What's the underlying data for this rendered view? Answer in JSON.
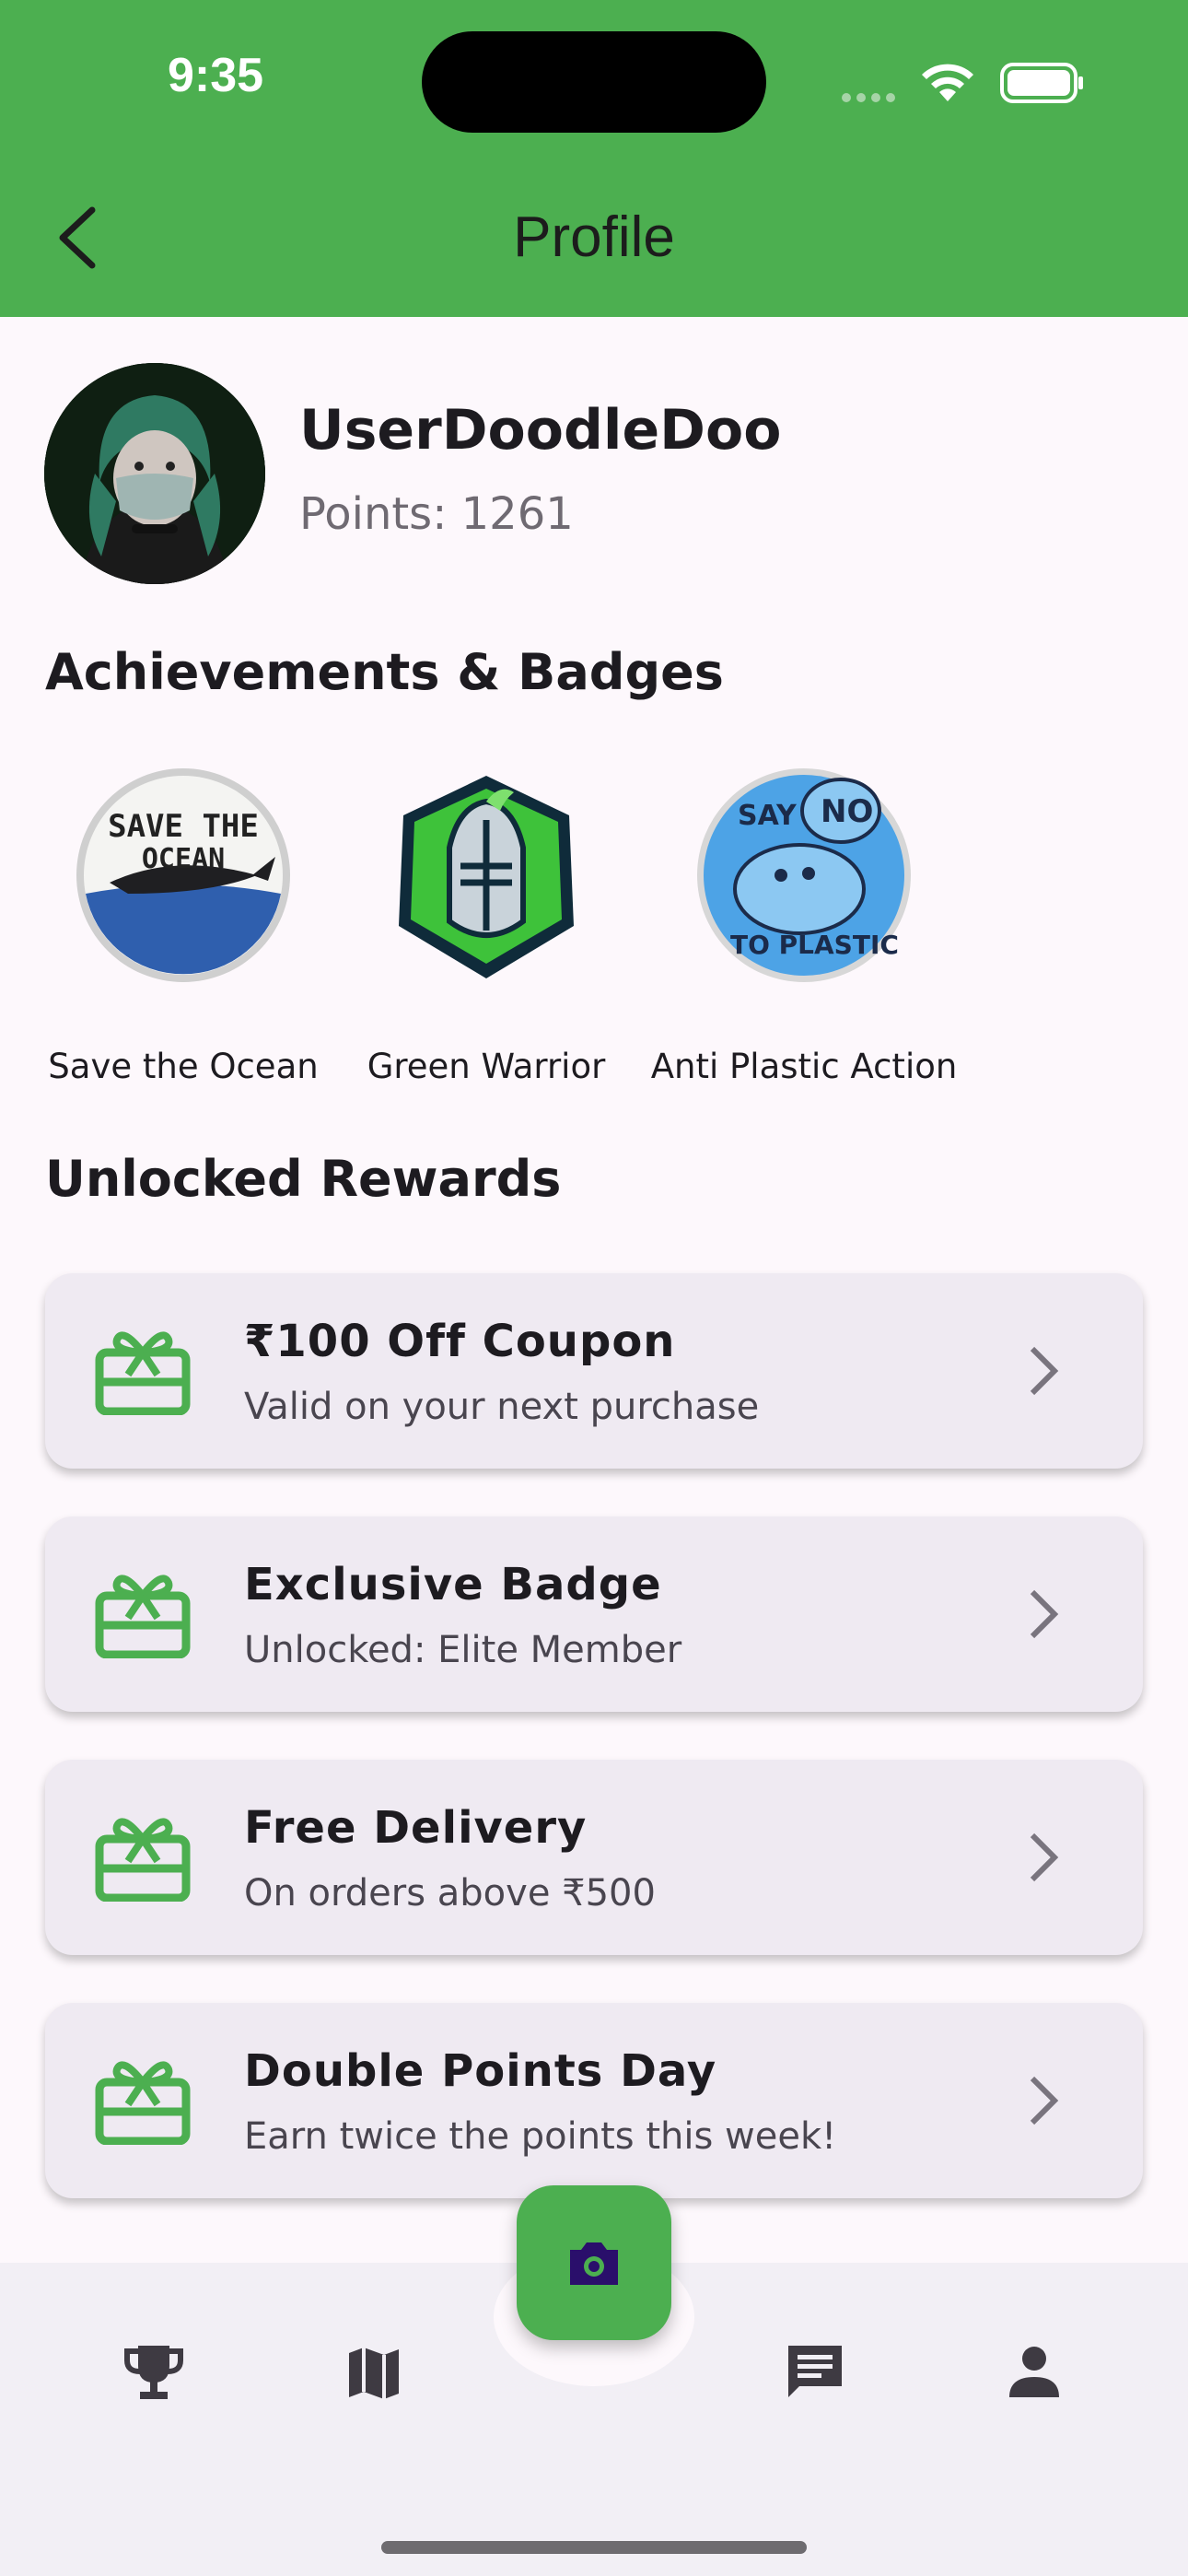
{
  "status_bar": {
    "time": "9:35"
  },
  "header": {
    "title": "Profile"
  },
  "profile": {
    "username": "UserDoodleDoo",
    "points_text": "Points: 1261"
  },
  "achievements": {
    "title": "Achievements & Badges",
    "badges": [
      {
        "label": "Save the Ocean",
        "badge_lettering": "SAVE THE OCEAN"
      },
      {
        "label": "Green Warrior"
      },
      {
        "label": "Anti Plastic Action",
        "badge_lettering": "SAY NO TO PLASTIC"
      }
    ]
  },
  "rewards": {
    "title": "Unlocked Rewards",
    "items": [
      {
        "title": "₹100 Off Coupon",
        "subtitle": "Valid on your next purchase"
      },
      {
        "title": "Exclusive Badge",
        "subtitle": "Unlocked: Elite Member"
      },
      {
        "title": "Free Delivery",
        "subtitle": "On orders above ₹500"
      },
      {
        "title": "Double Points Day",
        "subtitle": "Earn twice the points this week!"
      }
    ]
  },
  "bottom_nav": {
    "items": [
      {
        "icon": "trophy-icon"
      },
      {
        "icon": "map-icon"
      },
      {
        "icon": "camera-icon"
      },
      {
        "icon": "chat-icon"
      },
      {
        "icon": "person-icon"
      }
    ]
  },
  "colors": {
    "primary": "#4caf50",
    "card": "#efeaf2",
    "background": "#fdf8fc",
    "fab_icon": "#2a0f6b"
  }
}
